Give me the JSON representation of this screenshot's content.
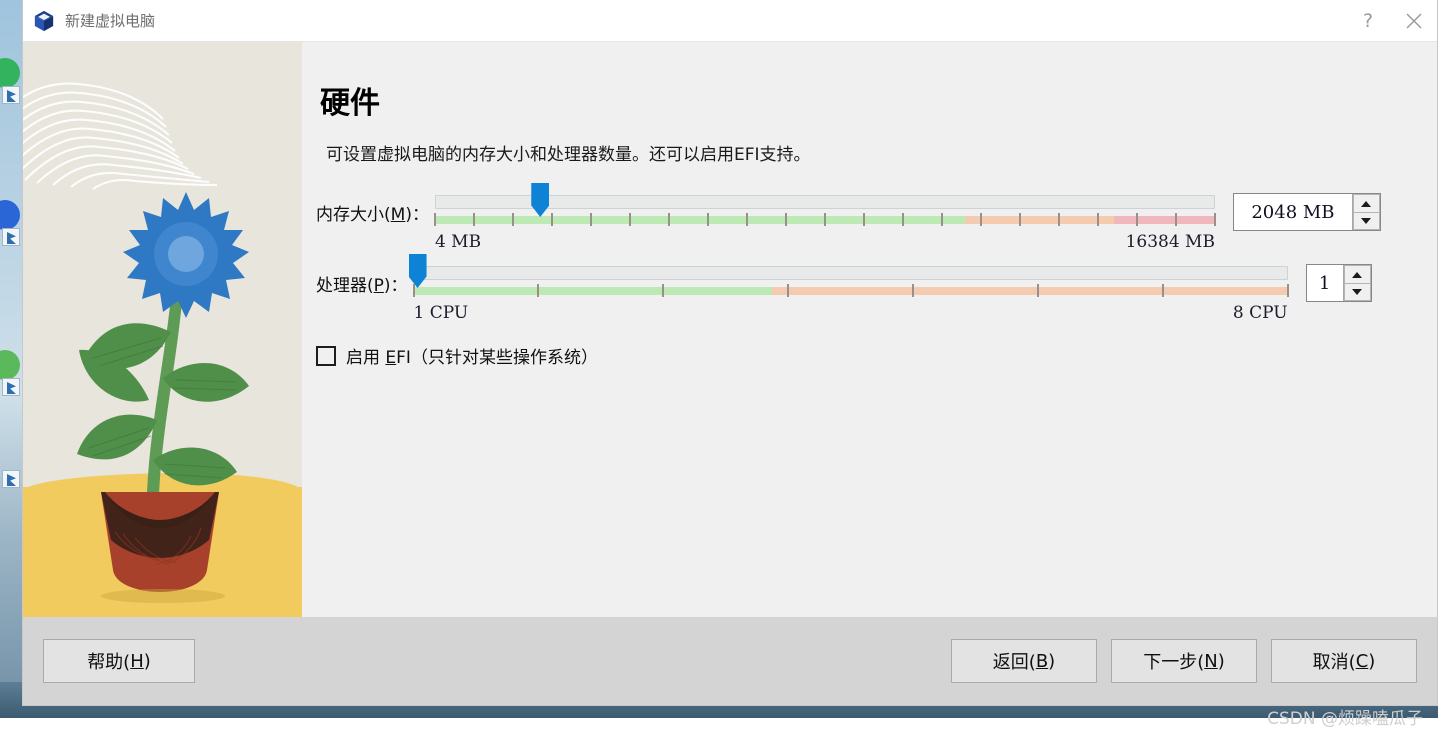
{
  "window": {
    "title": "新建虚拟电脑",
    "app_icon": "virtualbox-cube-icon",
    "help_button": "?",
    "close_button": "✕"
  },
  "page": {
    "title": "硬件",
    "description": "可设置虚拟电脑的内存大小和处理器数量。还可以启用EFI支持。"
  },
  "memory": {
    "label_prefix": "内存大小(",
    "label_mnemonic": "M",
    "label_suffix": ")：",
    "min_label": "4 MB",
    "max_label": "16384 MB",
    "value_text": "2048 MB",
    "value": 2048,
    "min": 4,
    "max": 16384,
    "handle_percent": 13.5,
    "green_end_percent": 68,
    "orange_end_percent": 87
  },
  "cpu": {
    "label_prefix": "处理器(",
    "label_mnemonic": "P",
    "label_suffix": ")：",
    "min_label": "1 CPU",
    "max_label": "8 CPU",
    "value_text": "1",
    "value": 1,
    "min": 1,
    "max": 8,
    "handle_percent": 0,
    "green_end_percent": 41
  },
  "efi": {
    "checked": false,
    "label_prefix": "启用 ",
    "label_mnemonic": "E",
    "label_suffix": "FI（只针对某些操作系统）"
  },
  "footer": {
    "help": {
      "prefix": "帮助(",
      "mnemonic": "H",
      "suffix": ")"
    },
    "back": {
      "prefix": "返回(",
      "mnemonic": "B",
      "suffix": ")"
    },
    "next": {
      "prefix": "下一步(",
      "mnemonic": "N",
      "suffix": ")"
    },
    "cancel": {
      "prefix": "取消(",
      "mnemonic": "C",
      "suffix": ")"
    }
  },
  "watermark": "CSDN @烦躁嗑瓜子",
  "colors": {
    "accent": "#0e83d6",
    "track_green": "#bdeab4",
    "track_orange": "#f5cbb0",
    "track_red": "#f0b7bc",
    "dialog_bg": "#f0f0f0",
    "footer_bg": "#d4d4d4",
    "sidebar_bg": "#e8e5dd",
    "floor_yellow": "#f2cb5e"
  }
}
